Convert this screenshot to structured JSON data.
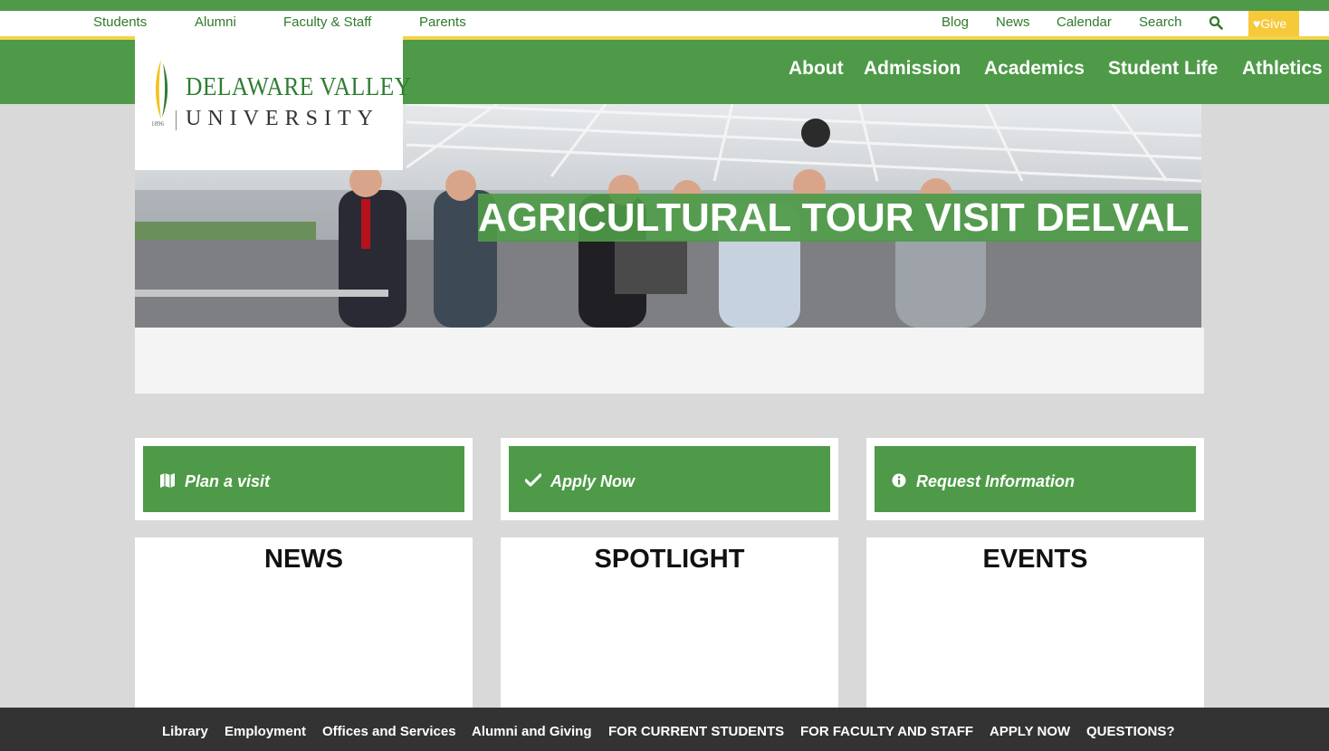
{
  "utility_nav": {
    "left": [
      "Students",
      "Alumni",
      "Faculty & Staff",
      "Parents"
    ],
    "right": [
      "Blog",
      "News",
      "Calendar",
      "Search"
    ],
    "give_label": "Give"
  },
  "logo": {
    "line1": "DELAWARE VALLEY",
    "line2": "UNIVERSITY",
    "year": "1896"
  },
  "main_nav": [
    "About",
    "Admission",
    "Academics",
    "Student Life",
    "Athletics"
  ],
  "hero": {
    "title": "AGRICULTURAL TOUR VISIT DELVAL"
  },
  "cta": [
    {
      "label": "Plan a visit",
      "icon": "map-icon"
    },
    {
      "label": "Apply Now",
      "icon": "check-icon"
    },
    {
      "label": "Request Information",
      "icon": "info-icon"
    }
  ],
  "panels": [
    "NEWS",
    "SPOTLIGHT",
    "EVENTS"
  ],
  "footer": [
    "Library",
    "Employment",
    "Offices and Services",
    "Alumni and Giving",
    "FOR CURRENT STUDENTS",
    "FOR FACULTY AND STAFF",
    "APPLY NOW",
    "QUESTIONS?"
  ],
  "colors": {
    "brand_green": "#4e9a48",
    "accent_gold": "#f5c93a",
    "footer_dark": "#333333"
  }
}
